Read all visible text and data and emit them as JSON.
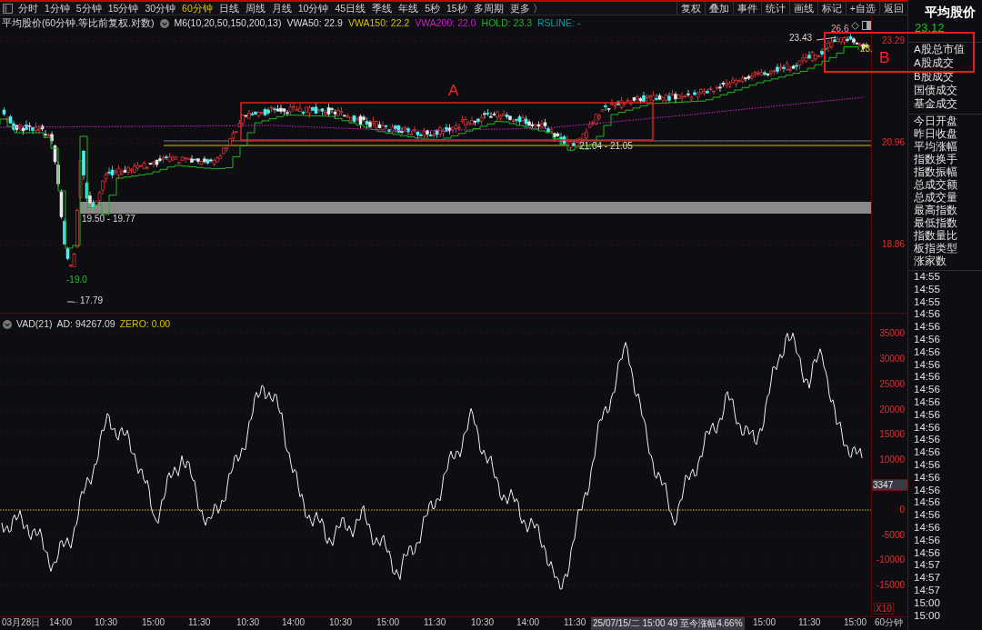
{
  "toolbar": {
    "tabs": [
      {
        "label": "分时",
        "selected": false
      },
      {
        "label": "1分钟",
        "selected": false
      },
      {
        "label": "5分钟",
        "selected": false
      },
      {
        "label": "15分钟",
        "selected": false
      },
      {
        "label": "30分钟",
        "selected": false
      },
      {
        "label": "60分钟",
        "selected": true
      },
      {
        "label": "日线",
        "selected": false
      },
      {
        "label": "周线",
        "selected": false
      },
      {
        "label": "月线",
        "selected": false
      },
      {
        "label": "10分钟",
        "selected": false
      },
      {
        "label": "45日线",
        "selected": false
      },
      {
        "label": "季线",
        "selected": false
      },
      {
        "label": "年线",
        "selected": false
      },
      {
        "label": "5秒",
        "selected": false
      },
      {
        "label": "15秒",
        "selected": false
      },
      {
        "label": "多周期",
        "selected": false
      },
      {
        "label": "更多 〉",
        "selected": false
      }
    ],
    "buttons": [
      "复权",
      "叠加",
      "事件",
      "统计",
      "画线",
      "标记",
      "+自选",
      "返回"
    ]
  },
  "legend": {
    "title": "平均股价(60分钟.等比前复权.对数)",
    "indicators": [
      {
        "text": "M6(10,20,50,150,200,13)",
        "color": "#dcdcdc"
      },
      {
        "text": "VWA50: 22.9",
        "color": "#dcdcdc"
      },
      {
        "text": "VWA150: 22.2",
        "color": "#d8c000"
      },
      {
        "text": "VWA200: 22.0",
        "color": "#c81ec8"
      },
      {
        "text": "HOLD: 23.3",
        "color": "#1eb41e"
      },
      {
        "text": "RSLINE: -",
        "color": "#0f9b9b"
      }
    ]
  },
  "price_axis": [
    "23.29",
    "20.96",
    "18.86"
  ],
  "zones": [
    {
      "label": "A"
    },
    {
      "label": "B"
    }
  ],
  "price_marks": [
    {
      "text": "23.43"
    },
    {
      "text": "26.6"
    },
    {
      "text": "23."
    },
    {
      "text": "21.04 - 21.05"
    },
    {
      "text": "19.50 - 19.77"
    },
    {
      "text": "-19.0"
    },
    {
      "text": "←17.79"
    }
  ],
  "indicator_panel": {
    "title": "VAD(21)",
    "ad": "AD: 94267.09",
    "zero": "ZERO: 0.00",
    "axis": [
      "35000",
      "30000",
      "25000",
      "20000",
      "15000",
      "10000",
      "0",
      "-5000",
      "-10000",
      "-15000"
    ],
    "cursor_value": "3347",
    "scale": "X10"
  },
  "time_axis": {
    "labels": [
      "03月28日",
      "14:00",
      "10:30",
      "15:00",
      "11:30",
      "10:30",
      "14:00",
      "10:30",
      "15:00",
      "11:30",
      "10:30",
      "14:00",
      "11:30",
      "15:00",
      "11:30",
      "15:00"
    ],
    "tooltip": "25/07/15/二 15:00 49 至今涨幅4.66%",
    "period": "60分钟"
  },
  "side_panel": {
    "title": "平均股价",
    "price": "23.12",
    "market_items": [
      "A股总市值",
      "A股成交",
      "B股成交",
      "国债成交",
      "基金成交"
    ],
    "stat_items": [
      "今日开盘",
      "昨日收盘",
      "平均涨幅",
      "指数换手",
      "指数振幅",
      "总成交额",
      "总成交量",
      "最高指数",
      "最低指数",
      "指数量比",
      "板指类型",
      "涨家数"
    ],
    "ticks": [
      "14:55",
      "14:55",
      "14:55",
      "14:56",
      "14:56",
      "14:56",
      "14:56",
      "14:56",
      "14:56",
      "14:56",
      "14:56",
      "14:56",
      "14:56",
      "14:56",
      "14:56",
      "14:56",
      "14:56",
      "14:56",
      "14:56",
      "14:56",
      "14:56",
      "14:56",
      "14:56",
      "14:57",
      "14:57",
      "14:57",
      "15:00",
      "15:00"
    ]
  }
}
